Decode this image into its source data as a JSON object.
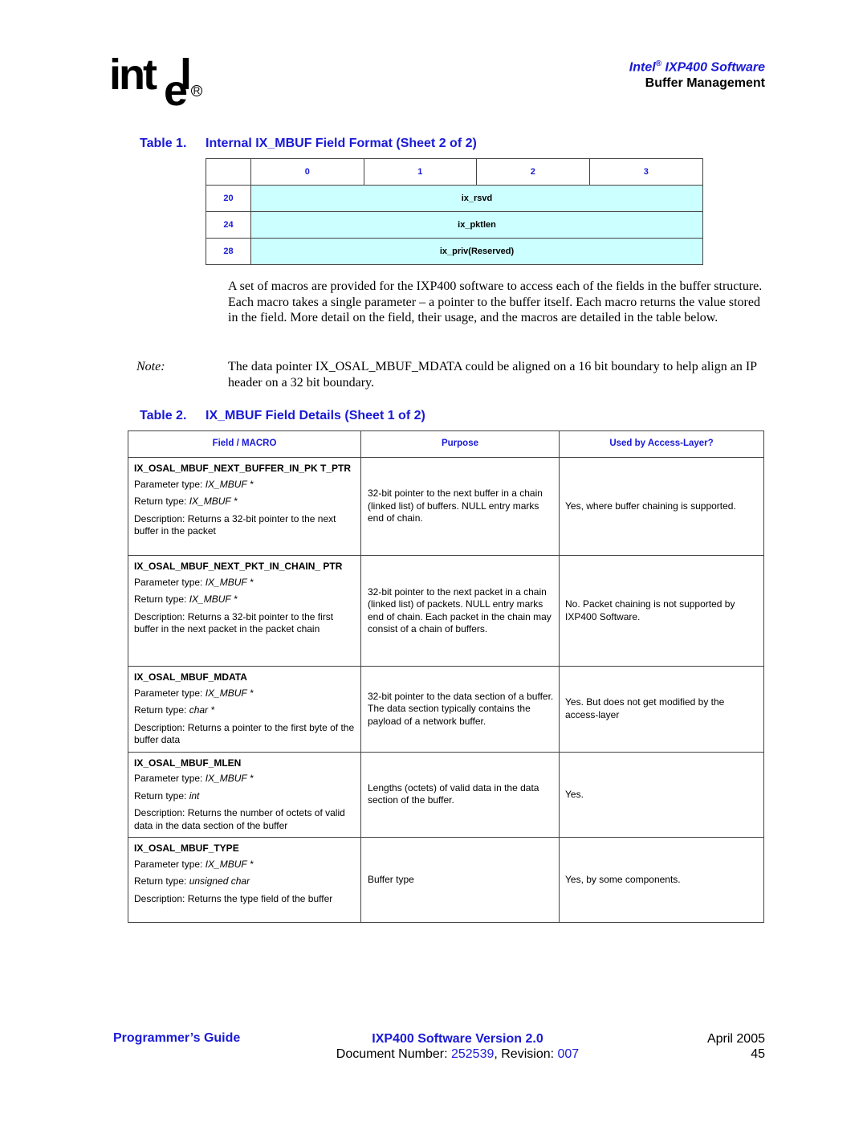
{
  "header": {
    "logo_text": "int",
    "logo_e": "e",
    "logo_l": "l",
    "logo_reg": "R",
    "title_pre": "Intel",
    "title_reg": "®",
    "title_post": " IXP400 Software",
    "section": "Buffer Management"
  },
  "table1": {
    "caption_num": "Table 1.",
    "caption_title": "Internal IX_MBUF Field Format (Sheet 2 of 2)",
    "columns": [
      "",
      "0",
      "1",
      "2",
      "3"
    ],
    "rows": [
      {
        "offset": "20",
        "field": "ix_rsvd"
      },
      {
        "offset": "24",
        "field": "ix_pktlen"
      },
      {
        "offset": "28",
        "field": "ix_priv(Reserved)"
      }
    ]
  },
  "body": {
    "paragraph": "A set of macros are provided for the IXP400 software to access each of the fields in the buffer structure. Each macro takes a single parameter – a pointer to the buffer itself. Each macro returns the value stored in the field. More detail on the field, their usage, and the macros are detailed in the table below.",
    "note_label": "Note:",
    "note_text": "The data pointer IX_OSAL_MBUF_MDATA could be aligned on a 16 bit boundary to help align an IP header on a 32 bit boundary."
  },
  "table2": {
    "caption_num": "Table 2.",
    "caption_title": "IX_MBUF Field Details (Sheet 1 of 2)",
    "headers": [
      "Field / MACRO",
      "Purpose",
      "Used by Access-Layer?"
    ],
    "param_label": "Parameter type: ",
    "return_label": "Return type: ",
    "rows": [
      {
        "macro": "IX_OSAL_MBUF_NEXT_BUFFER_IN_PK T_PTR",
        "param_type": "IX_MBUF *",
        "return_type": "IX_MBUF *",
        "description": "Description: Returns a 32-bit pointer to the next buffer in the packet",
        "purpose": "32-bit pointer to the next buffer in a chain (linked list) of buffers. NULL entry marks end of chain.",
        "used": "Yes, where buffer chaining is supported."
      },
      {
        "macro": "IX_OSAL_MBUF_NEXT_PKT_IN_CHAIN_ PTR",
        "param_type": "IX_MBUF *",
        "return_type": "IX_MBUF *",
        "description": "Description: Returns a 32-bit pointer to the first buffer in the next packet in the packet chain",
        "purpose": "32-bit pointer to the next packet in a chain (linked list) of packets. NULL entry marks end of chain. Each packet in the chain may consist of a chain of buffers.",
        "used": "No. Packet chaining is not supported by IXP400 Software."
      },
      {
        "macro": "IX_OSAL_MBUF_MDATA",
        "param_type": "IX_MBUF *",
        "return_type": "char *",
        "description": "Description: Returns a pointer to the first byte of the buffer data",
        "purpose": "32-bit pointer to the data section of a buffer. The data section typically contains the payload of a network buffer.",
        "used": "Yes. But does not get modified by the access-layer"
      },
      {
        "macro": "IX_OSAL_MBUF_MLEN",
        "param_type": "IX_MBUF *",
        "return_type": "int",
        "description": "Description: Returns the number of octets of valid data in the data section of the buffer",
        "purpose": "Lengths (octets) of valid data in the data section of the buffer.",
        "used": "Yes."
      },
      {
        "macro": "IX_OSAL_MBUF_TYPE",
        "param_type": "IX_MBUF *",
        "return_type": "unsigned char",
        "description": "Description: Returns the type field of the buffer",
        "purpose": "Buffer type",
        "used": "Yes, by some components."
      }
    ]
  },
  "footer": {
    "guide": "Programmer’s Guide",
    "version": "IXP400 Software Version 2.0",
    "doc_label": "Document Number: ",
    "doc_number": "252539",
    "rev_label": ", Revision: ",
    "revision": "007",
    "date": "April 2005",
    "page": "45"
  },
  "colors": {
    "accent_blue": "#1a1ad6",
    "cell_fill": "#ccffff"
  }
}
